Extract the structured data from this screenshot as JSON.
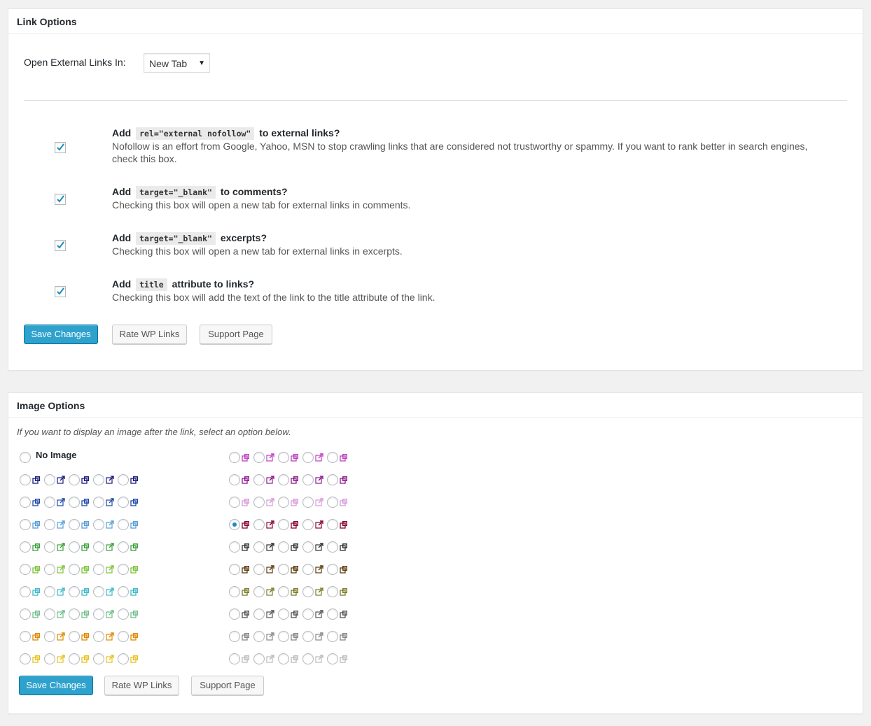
{
  "link_options": {
    "title": "Link Options",
    "open_external_label": "Open External Links In:",
    "open_external_value": "New Tab",
    "options": [
      {
        "pre": "Add",
        "code": "rel=\"external nofollow\"",
        "post": "to external links?",
        "desc": "Nofollow is an effort from Google, Yahoo, MSN to stop crawling links that are considered not trustworthy or spammy. If you want to rank better in search engines, check this box.",
        "checked": true
      },
      {
        "pre": "Add",
        "code": "target=\"_blank\"",
        "post": "to comments?",
        "desc": "Checking this box will open a new tab for external links in comments.",
        "checked": true
      },
      {
        "pre": "Add",
        "code": "target=\"_blank\"",
        "post": "excerpts?",
        "desc": "Checking this box will open a new tab for external links in excerpts.",
        "checked": true
      },
      {
        "pre": "Add",
        "code": "title",
        "post": "attribute to links?",
        "desc": "Checking this box will add the text of the link to the title attribute of the link.",
        "checked": true
      }
    ],
    "save_label": "Save Changes",
    "rate_label": "Rate WP Links",
    "support_label": "Support Page"
  },
  "image_options": {
    "title": "Image Options",
    "intro": "If you want to display an image after the link, select an option below.",
    "no_image_label": "No Image",
    "left_colors": [
      "#1a1a7a",
      "#1f4aa8",
      "#5aa0d8",
      "#3da03d",
      "#7ec43a",
      "#3fb8c8",
      "#6fbf8a",
      "#e08a00",
      "#e6c21c"
    ],
    "right_colors": [
      "#c040c0",
      "#8a1a8a",
      "#d89ad8",
      "#8a0033",
      "#333333",
      "#5a3a0a",
      "#7a7a2a",
      "#555555",
      "#888888",
      "#bbbbbb"
    ],
    "icon_types": [
      "double-window-icon",
      "external-arrow-icon",
      "double-window-icon",
      "external-arrow-icon",
      "double-window-icon"
    ],
    "selected": "right-row-4",
    "save_label": "Save Changes",
    "rate_label": "Rate WP Links",
    "support_label": "Support Page"
  },
  "colors": {
    "primary": "#2ea2cc",
    "check": "#1e8cbe"
  }
}
